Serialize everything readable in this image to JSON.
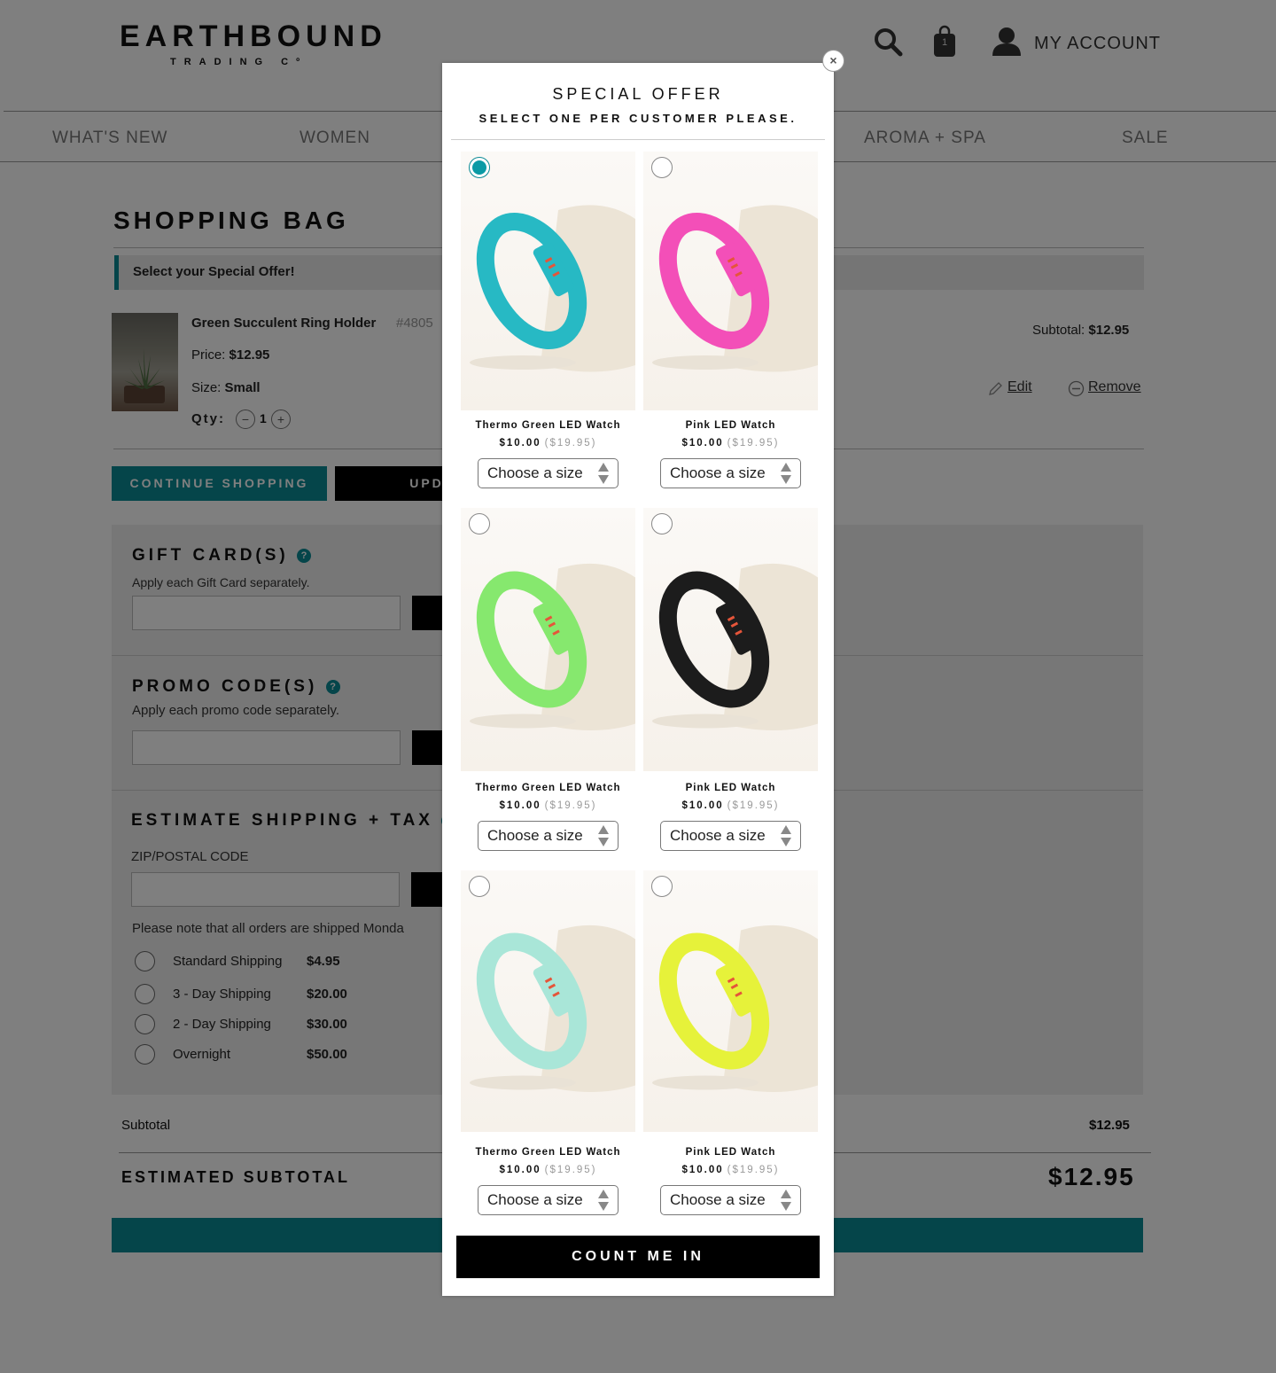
{
  "header": {
    "logo_main": "EARTHBOUND",
    "logo_sub": "TRADING Cº",
    "cart_count": "1",
    "account_label": "MY ACCOUNT"
  },
  "nav": [
    "WHAT'S NEW",
    "WOMEN",
    "AROMA + SPA",
    "SALE"
  ],
  "bag": {
    "title": "SHOPPING BAG",
    "offer_banner": "Select your Special Offer!",
    "item": {
      "name": "Green Succulent Ring Holder",
      "sku": "#4805",
      "price_label": "Price:",
      "price": "$12.95",
      "size_label": "Size:",
      "size": "Small",
      "qty_label": "Qty:",
      "qty": "1",
      "subtotal_label": "Subtotal:",
      "subtotal": "$12.95",
      "edit": "Edit",
      "remove": "Remove"
    },
    "continue_label": "CONTINUE SHOPPING",
    "update_label": "UPDATE"
  },
  "gift": {
    "title": "GIFT CARD(S)",
    "note": "Apply each Gift Card separately."
  },
  "promo": {
    "title": "PROMO CODE(S)",
    "note": "Apply each promo code separately."
  },
  "shipping": {
    "title": "ESTIMATE SHIPPING + TAX",
    "zip_label": "ZIP/POSTAL CODE",
    "note": "Please note that all orders are shipped Monda",
    "options": [
      {
        "label": "Standard Shipping",
        "price": "$4.95"
      },
      {
        "label": "3 - Day Shipping",
        "price": "$20.00"
      },
      {
        "label": "2 - Day Shipping",
        "price": "$30.00"
      },
      {
        "label": "Overnight",
        "price": "$50.00"
      }
    ]
  },
  "totals": {
    "subtotal_label": "Subtotal",
    "subtotal": "$12.95",
    "estimated_label": "ESTIMATED SUBTOTAL",
    "estimated": "$12.95"
  },
  "modal": {
    "close": "×",
    "title": "SPECIAL OFFER",
    "subtitle": "SELECT ONE PER CUSTOMER PLEASE.",
    "products": [
      {
        "name": "Thermo Green LED Watch",
        "price": "$10.00",
        "orig": "($19.95)",
        "select": "Choose a size",
        "band_color": "#27b9c4",
        "selected": true
      },
      {
        "name": "Pink LED Watch",
        "price": "$10.00",
        "orig": "($19.95)",
        "select": "Choose a size",
        "band_color": "#f34fb8",
        "selected": false
      },
      {
        "name": "Thermo Green LED Watch",
        "price": "$10.00",
        "orig": "($19.95)",
        "select": "Choose a size",
        "band_color": "#86e86e",
        "selected": false
      },
      {
        "name": "Pink LED Watch",
        "price": "$10.00",
        "orig": "($19.95)",
        "select": "Choose a size",
        "band_color": "#1c1c1c",
        "selected": false
      },
      {
        "name": "Thermo Green LED Watch",
        "price": "$10.00",
        "orig": "($19.95)",
        "select": "Choose a size",
        "band_color": "#a9e6d8",
        "selected": false
      },
      {
        "name": "Pink LED Watch",
        "price": "$10.00",
        "orig": "($19.95)",
        "select": "Choose a size",
        "band_color": "#e6f23a",
        "selected": false
      }
    ],
    "cta": "COUNT ME IN"
  },
  "colors": {
    "accent": "#0a8a95",
    "overlay": "rgba(0,0,0,0.5)"
  }
}
